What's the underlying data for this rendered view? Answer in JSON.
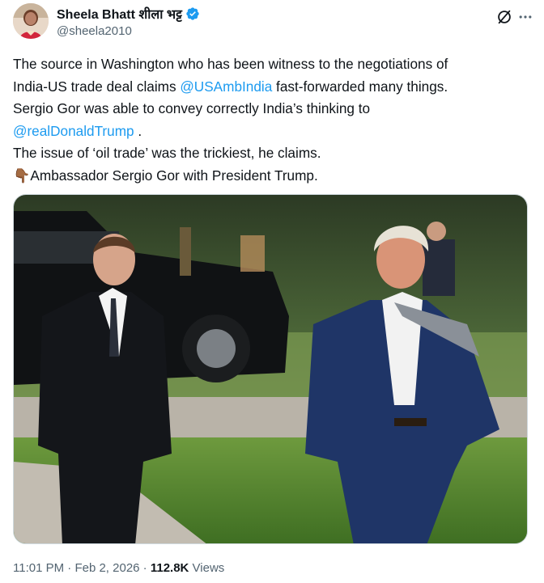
{
  "author": {
    "display_name": "Sheela Bhatt शीला भट्ट",
    "handle": "@sheela2010",
    "verified": true,
    "avatar_icon": "profile-avatar"
  },
  "actions": {
    "grok_icon": "grok-icon",
    "more_icon": "more-icon"
  },
  "tweet": {
    "line1": "The source in Washington who has been witness to the negotiations of",
    "line2_pre": "India-US trade deal claims ",
    "line2_mention": "@USAmbIndia",
    "line2_post": " fast-forwarded many things.",
    "line3": "Sergio Gor was able to convey correctly India’s thinking to",
    "line4_mention": "@realDonaldTrump",
    "line4_post": " .",
    "line5": "The issue of ‘oil trade’ was the trickiest, he claims.",
    "line6_emoji": "👇🏾",
    "line6_text": "Ambassador Sergio Gor with President Trump."
  },
  "media": {
    "kind": "photo"
  },
  "meta": {
    "time": "11:01 PM",
    "sep1": " · ",
    "date": "Feb 2, 2026",
    "sep2": " · ",
    "views_count": "112.8K",
    "views_label": " Views"
  },
  "colors": {
    "accent": "#1d9bf0",
    "text": "#0f1419",
    "muted": "#536471"
  }
}
